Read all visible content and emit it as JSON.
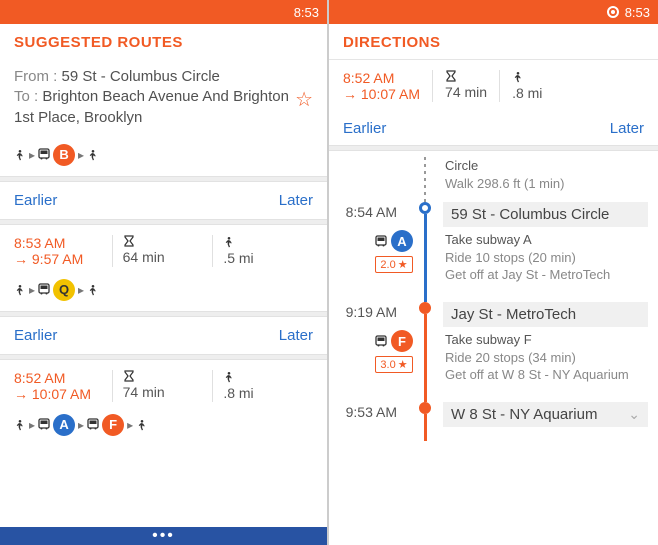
{
  "status_time": "8:53",
  "left": {
    "title": "SUGGESTED ROUTES",
    "from_label": "From : ",
    "from_value": "59 St - Columbus Circle",
    "to_label": "To : ",
    "to_value": "Brighton Beach Avenue And Brighton 1st Place, Brooklyn",
    "earlier": "Earlier",
    "later": "Later",
    "route1": {
      "line_letter": "B",
      "line_color": "#f15a24"
    },
    "route2": {
      "depart": "8:53 AM",
      "arrive": "→ 9:57 AM",
      "duration": "64 min",
      "walk": ".5 mi",
      "line_letter": "Q",
      "line_color": "#f2c200"
    },
    "route3": {
      "depart": "8:52 AM",
      "arrive": "→ 10:07 AM",
      "duration": "74 min",
      "walk": ".8 mi",
      "line_a_letter": "A",
      "line_a_color": "#2a6fc9",
      "line_f_letter": "F",
      "line_f_color": "#f15a24"
    },
    "more": "•••"
  },
  "right": {
    "title": "DIRECTIONS",
    "depart": "8:52 AM",
    "arrive": "→ 10:07 AM",
    "duration": "74 min",
    "walk": ".8 mi",
    "earlier": "Earlier",
    "later": "Later",
    "step0": {
      "title": "Circle",
      "sub": "Walk 298.6 ft (1 min)"
    },
    "step1": {
      "time": "8:54 AM",
      "title": "59 St - Columbus Circle",
      "action": "Take subway A",
      "ride": "Ride 10 stops (20 min)",
      "getoff": "Get off at Jay St - MetroTech",
      "line_letter": "A",
      "line_color": "#2a6fc9",
      "rating": "2.0"
    },
    "step2": {
      "time": "9:19 AM",
      "title": "Jay St - MetroTech",
      "action": "Take subway F",
      "ride": "Ride 20 stops (34 min)",
      "getoff": "Get off at W 8 St - NY Aquarium",
      "line_letter": "F",
      "line_color": "#f15a24",
      "rating": "3.0"
    },
    "step3": {
      "time": "9:53 AM",
      "title": "W 8 St - NY Aquarium"
    }
  }
}
